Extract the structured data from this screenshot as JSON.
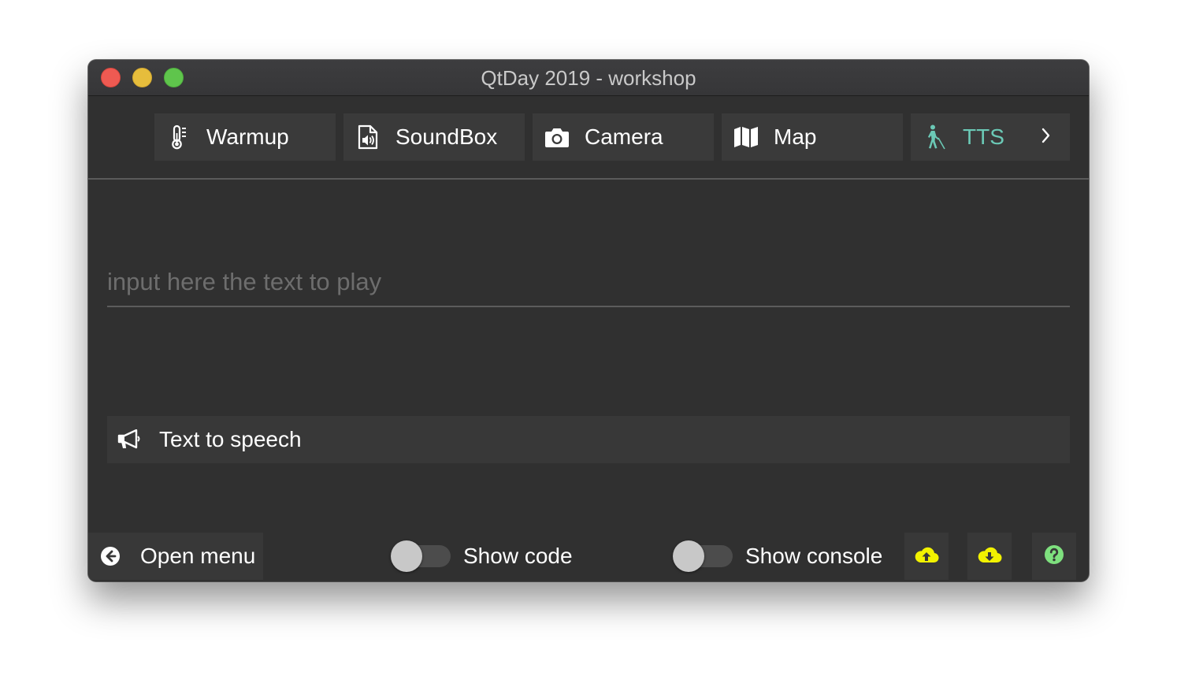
{
  "window": {
    "title": "QtDay 2019 - workshop"
  },
  "tabs": [
    {
      "label": "Warmup",
      "icon": "thermometer-icon"
    },
    {
      "label": "SoundBox",
      "icon": "audio-file-icon"
    },
    {
      "label": "Camera",
      "icon": "camera-icon"
    },
    {
      "label": "Map",
      "icon": "map-icon"
    },
    {
      "label": "TTS",
      "icon": "blind-person-icon",
      "active": true
    }
  ],
  "tts": {
    "input_value": "",
    "input_placeholder": "input here the text to play",
    "speak_button_label": "Text to speech"
  },
  "footer": {
    "open_menu_label": "Open menu",
    "show_code_label": "Show code",
    "show_code_on": false,
    "show_console_label": "Show console",
    "show_console_on": false
  },
  "colors": {
    "background": "#303030",
    "active_tab_text": "#6bc9b6",
    "upload_icon": "#f2f200",
    "download_icon": "#f2f200",
    "help_icon": "#7ee07e"
  }
}
